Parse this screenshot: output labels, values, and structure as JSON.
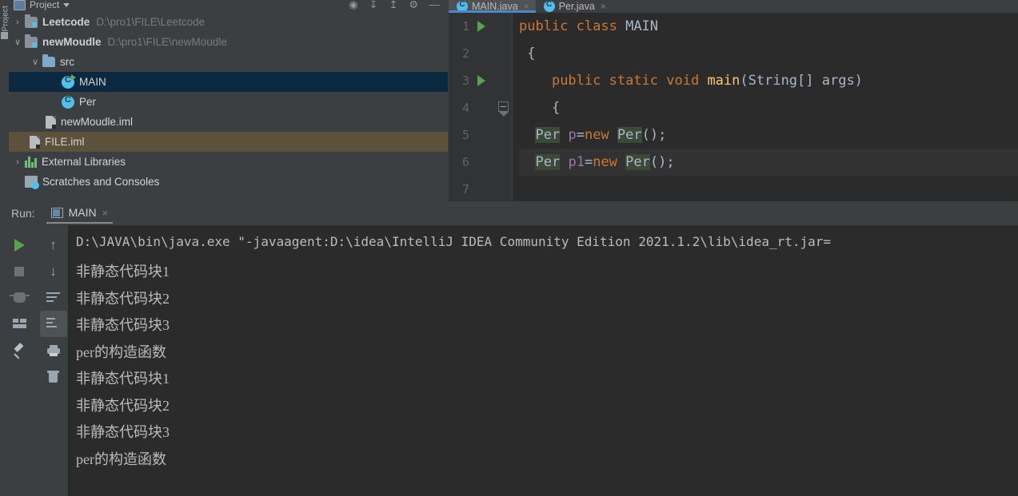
{
  "tool_strip": {
    "label": "Project",
    "minimize_icon": "window-icon"
  },
  "project_panel": {
    "title": "Project",
    "title_caret": "chevron-down-icon",
    "header_icons": [
      "collapse-all-icon",
      "expand-all-icon",
      "settings-icon",
      "hide-icon"
    ],
    "tree": [
      {
        "id": "leetcode",
        "arrow": "›",
        "icon": "module-icon",
        "label": "Leetcode",
        "path": "D:\\pro1\\FILE\\Leetcode",
        "indent": 0,
        "bold": true,
        "state": "normal"
      },
      {
        "id": "newmoudle",
        "arrow": "∨",
        "icon": "module-icon",
        "label": "newMoudle",
        "path": "D:\\pro1\\FILE\\newMoudle",
        "indent": 0,
        "bold": true,
        "state": "normal"
      },
      {
        "id": "src",
        "arrow": "∨",
        "icon": "folder-icon",
        "label": "src",
        "path": "",
        "indent": 1,
        "bold": false,
        "state": "normal"
      },
      {
        "id": "main",
        "arrow": "",
        "icon": "java-class-runnable-icon",
        "label": "MAIN",
        "path": "",
        "indent": 2,
        "bold": false,
        "state": "selected-blue"
      },
      {
        "id": "per",
        "arrow": "",
        "icon": "java-class-icon",
        "label": "Per",
        "path": "",
        "indent": 2,
        "bold": false,
        "state": "normal"
      },
      {
        "id": "newmoudle-iml",
        "arrow": "",
        "icon": "iml-file-icon",
        "label": "newMoudle.iml",
        "path": "",
        "indent": 1,
        "bold": false,
        "state": "normal"
      },
      {
        "id": "file-iml",
        "arrow": "",
        "icon": "iml-file-icon",
        "label": "FILE.iml",
        "path": "",
        "indent": 0,
        "bold": false,
        "state": "selected-olive"
      },
      {
        "id": "external-libraries",
        "arrow": "›",
        "icon": "libraries-icon",
        "label": "External Libraries",
        "path": "",
        "indent": 0,
        "bold": false,
        "state": "normal"
      },
      {
        "id": "scratches",
        "arrow": "",
        "icon": "scratches-icon",
        "label": "Scratches and Consoles",
        "path": "",
        "indent": 0,
        "bold": false,
        "state": "normal"
      }
    ]
  },
  "editor": {
    "tabs": [
      {
        "label": "MAIN.java",
        "icon": "java-class-icon",
        "close": "×",
        "active": true
      },
      {
        "label": "Per.java",
        "icon": "java-class-icon",
        "close": "×",
        "active": false
      }
    ],
    "lines": [
      {
        "num": "1",
        "gutter": "run-marker",
        "fold": false,
        "highlight": false
      },
      {
        "num": "2",
        "gutter": "",
        "fold": false,
        "highlight": false
      },
      {
        "num": "3",
        "gutter": "run-marker",
        "fold": false,
        "highlight": false
      },
      {
        "num": "4",
        "gutter": "",
        "fold": true,
        "highlight": false
      },
      {
        "num": "5",
        "gutter": "",
        "fold": false,
        "highlight": false
      },
      {
        "num": "6",
        "gutter": "",
        "fold": false,
        "highlight": true
      },
      {
        "num": "7",
        "gutter": "",
        "fold": false,
        "highlight": false
      }
    ],
    "code_text": [
      "public class MAIN",
      "{",
      "    public static void main(String[] args)",
      "    {",
      "  Per p=new Per();",
      "  Per p1=new Per();",
      ""
    ]
  },
  "run_panel": {
    "run_label": "Run:",
    "tab_label": "MAIN",
    "tab_icon": "console-icon",
    "tab_close": "×",
    "left_toolbar": [
      {
        "name": "rerun-button",
        "icon": "play-icon"
      },
      {
        "name": "stop-button",
        "icon": "stop-icon"
      },
      {
        "name": "debug-button",
        "icon": "bug-icon"
      },
      {
        "name": "layout-button",
        "icon": "layout-icon"
      },
      {
        "name": "pin-tab-button",
        "icon": "pin-icon"
      }
    ],
    "right_toolbar": [
      {
        "name": "up-button",
        "icon": "arrow-up-icon"
      },
      {
        "name": "down-button",
        "icon": "arrow-down-icon"
      },
      {
        "name": "soft-wrap-button",
        "icon": "soft-wrap-icon"
      },
      {
        "name": "scroll-to-end-button",
        "icon": "scroll-to-end-icon"
      },
      {
        "name": "print-button",
        "icon": "printer-icon"
      },
      {
        "name": "clear-all-button",
        "icon": "trash-icon"
      }
    ],
    "console_command": "D:\\JAVA\\bin\\java.exe \"-javaagent:D:\\idea\\IntelliJ IDEA Community Edition 2021.1.2\\lib\\idea_rt.jar=",
    "console_output": [
      "非静态代码块1",
      "非静态代码块2",
      "非静态代码块3",
      "per的构造函数",
      "非静态代码块1",
      "非静态代码块2",
      "非静态代码块3",
      "per的构造函数"
    ]
  },
  "colors": {
    "panel_bg": "#3c3f41",
    "editor_bg": "#2b2b2b",
    "gutter_bg": "#313335",
    "keyword": "#cc7832",
    "identifier": "#9876aa",
    "method": "#ffc66d",
    "text": "#a9b7c6",
    "selection_blue": "#0d293f",
    "selection_olive": "#5c513a",
    "tab_underline": "#4a88c7",
    "run_green": "#59a14f",
    "usage_highlight": "#3b4a36"
  }
}
